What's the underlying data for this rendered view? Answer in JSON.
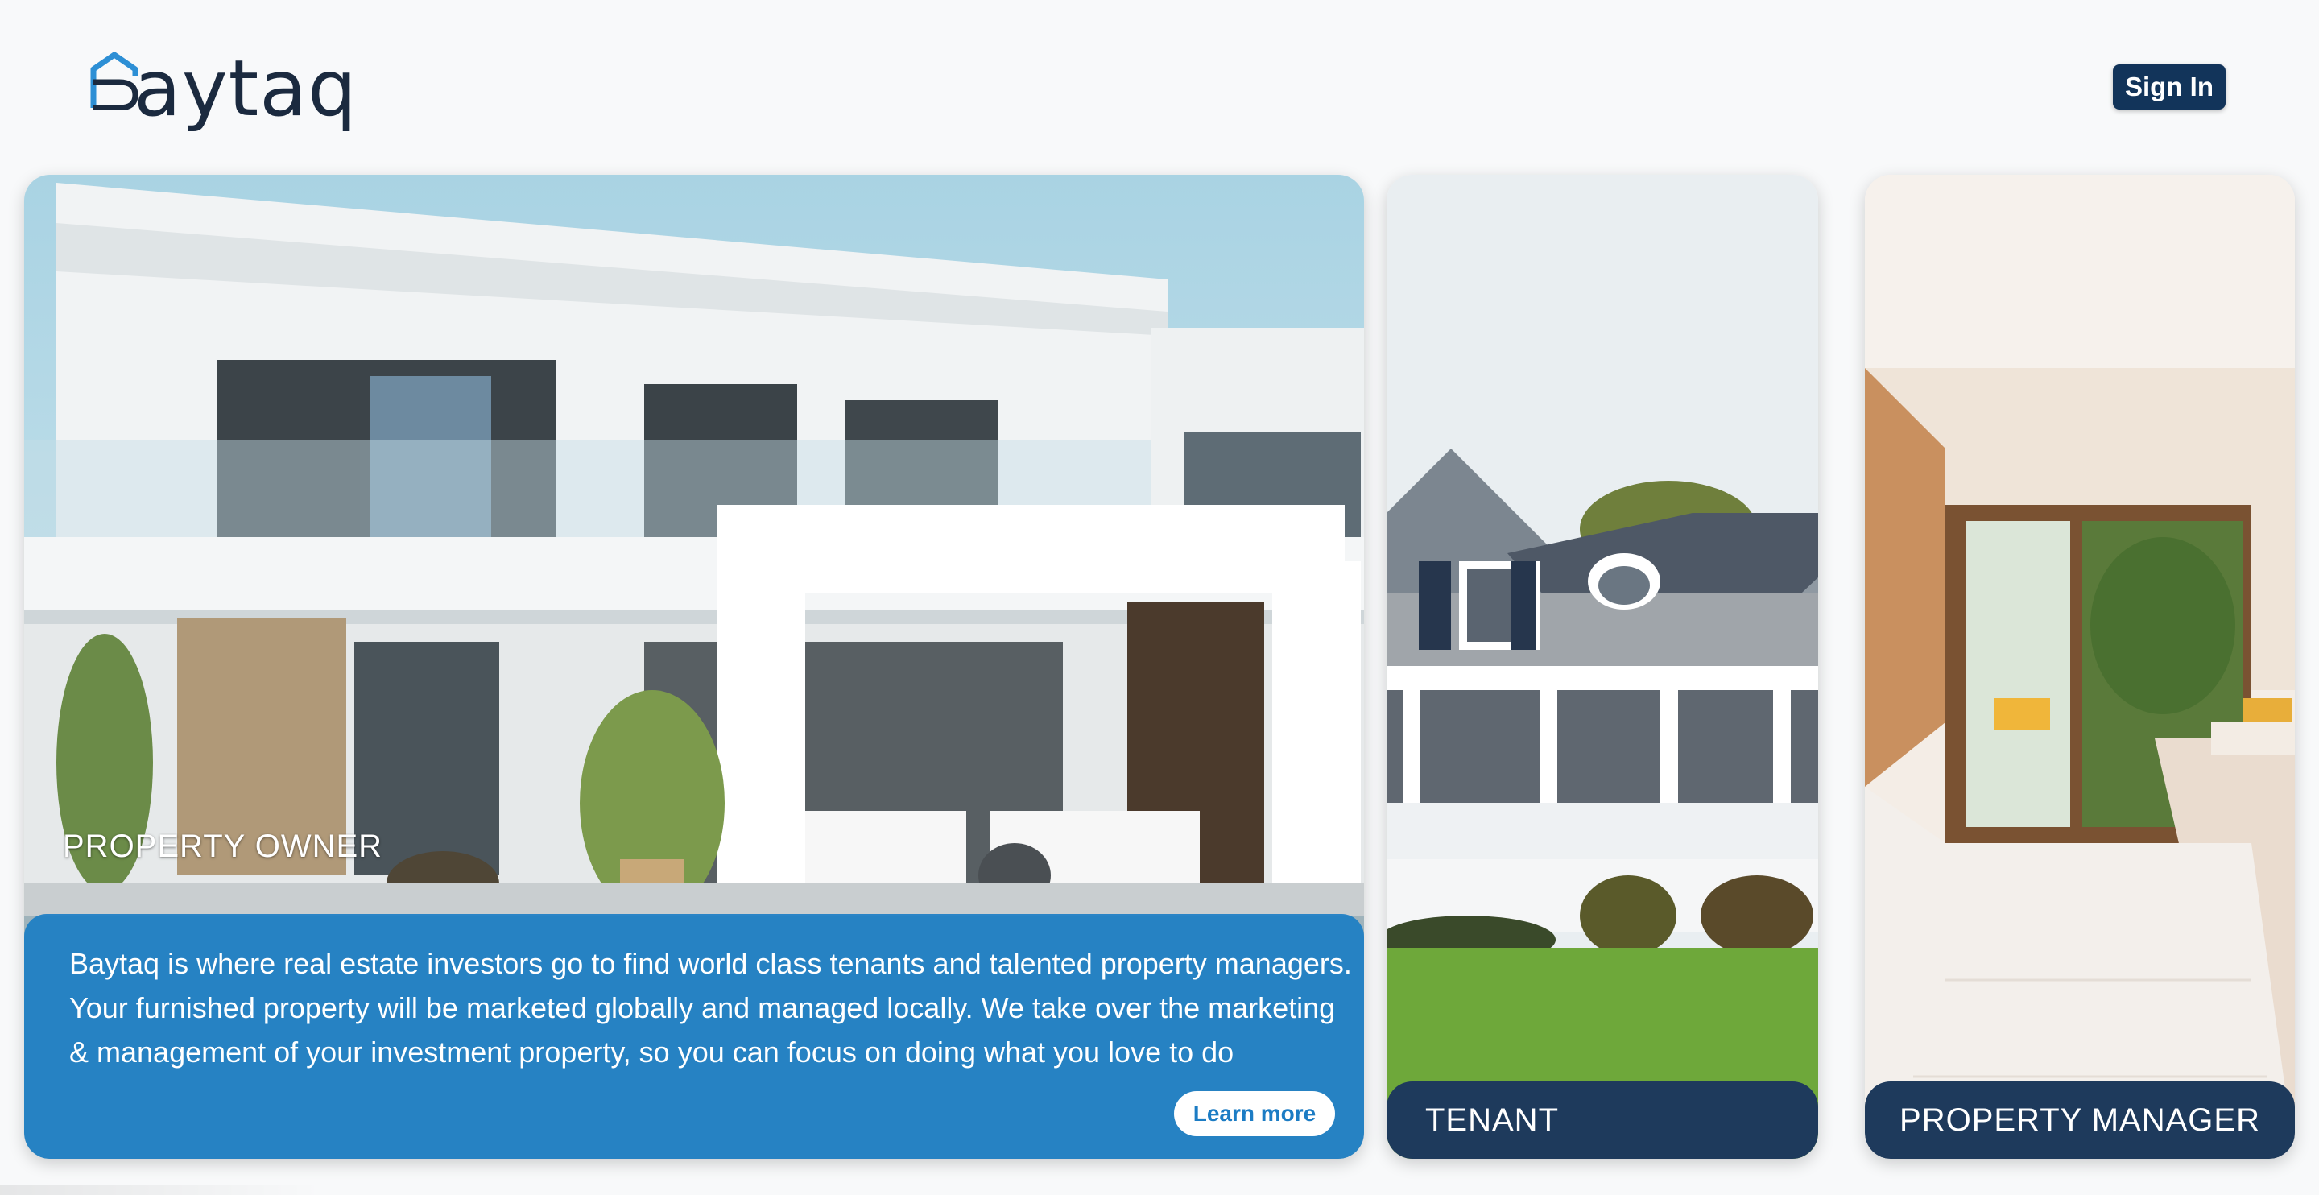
{
  "brand": {
    "name": "aytaq",
    "full_name": "Baytaq",
    "logo_mark": "B-house-mark",
    "color": "#1b2a3f",
    "accent": "#2d8fd5"
  },
  "header": {
    "sign_in_label": "Sign In"
  },
  "cards": {
    "owner": {
      "title": "PROPERTY OWNER",
      "description": "Baytaq is where real estate investors go to find world class tenants and talented property managers. Your furnished property will be marketed globally and managed locally. We take over the marketing & management of your investment property, so you can focus on doing what you love to do",
      "learn_more_label": "Learn more",
      "image": "modern-white-villa-photo"
    },
    "tenant": {
      "title": "TENANT",
      "image": "grey-shingle-house-photo"
    },
    "manager": {
      "title": "PROPERTY MANAGER",
      "image": "bright-kitchen-interior-photo"
    }
  },
  "colors": {
    "primary_dark": "#12345a",
    "panel_blue": "#187cc4",
    "label_navy": "#1e3a5c"
  }
}
